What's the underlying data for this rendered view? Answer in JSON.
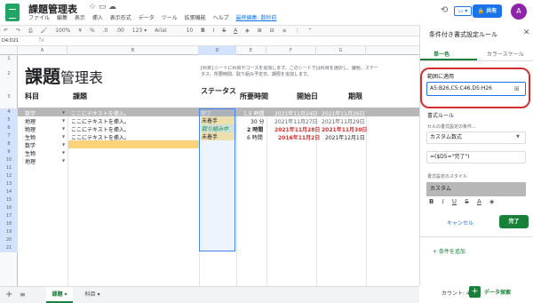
{
  "app": {
    "title": "課題管理表",
    "last_edit": "最終編集: 数秒前"
  },
  "menu": {
    "file": "ファイル",
    "edit": "編集",
    "view": "表示",
    "insert": "挿入",
    "format": "表示形式",
    "data": "データ",
    "tools": "ツール",
    "extensions": "拡張機能",
    "help": "ヘルプ"
  },
  "header": {
    "present": "▭ ▾",
    "share": "共有",
    "avatar": "A"
  },
  "toolbar": {
    "zoom": "100%",
    "percent": "%",
    "dec0": ".0",
    "dec00": ".00",
    "numfmt": "123 ▾",
    "font": "Arial",
    "fontsize": "10",
    "bold": "B",
    "italic": "I",
    "strike": "S",
    "color": "A"
  },
  "formula_bar": {
    "namebox": "D4:D21",
    "fx": "fx"
  },
  "columns": [
    "A",
    "B",
    "C",
    "D",
    "E",
    "F",
    "G"
  ],
  "rows": [
    "1",
    "2",
    "3",
    "4",
    "5",
    "6",
    "7",
    "8",
    "9",
    "10",
    "11",
    "12",
    "13",
    "14",
    "15",
    "16",
    "17",
    "18",
    "19",
    "20",
    "21"
  ],
  "sheet": {
    "title": "課題",
    "title_rest": "管理表",
    "desc": "[科目] シートに科目やコースを追加します。このシートでは科目を選択し、課題、ステータス、所要時間、取り組み予定日、期限を追加します。",
    "headers": {
      "subject": "科目",
      "task": "課題",
      "status": "ステータス",
      "time": "所要時間",
      "start": "開始日",
      "due": "期限"
    },
    "rows": [
      {
        "subject": "数学",
        "task": "ここにテキストを挿入。",
        "status": "完了",
        "time": "1.5 時間",
        "start": "2021年11月24日",
        "due": "2021年11月26日"
      },
      {
        "subject": "地理",
        "task": "ここにテキストを挿入。",
        "status": "未着手",
        "time": "30 分",
        "start": "2021年11月27日",
        "due": "2021年11月29日"
      },
      {
        "subject": "物理",
        "task": "ここにテキストを挿入。",
        "status": "取り組み中",
        "time": "2 時間",
        "start": "2021年11月28日",
        "due": "2021年11月30日"
      },
      {
        "subject": "生物",
        "task": "ここにテキストを挿入。",
        "status": "未着手",
        "time": "6 時間",
        "start": "2016年11月2日",
        "due": "2021年12月1日"
      },
      {
        "subject": "数学",
        "task": "",
        "status": "",
        "time": "",
        "start": "",
        "due": ""
      },
      {
        "subject": "生物",
        "task": "",
        "status": "",
        "time": "",
        "start": "",
        "due": ""
      },
      {
        "subject": "地理",
        "task": "",
        "status": "",
        "time": "",
        "start": "",
        "due": ""
      }
    ]
  },
  "tabs": {
    "plus": "+",
    "list": "≡",
    "sheet1": "課題 ▾",
    "sheet2": "科目 ▾"
  },
  "status_bar": {
    "count": "カウント: 4",
    "explore": "データ探索"
  },
  "panel": {
    "title": "条件付き書式設定ルール",
    "close": "✕",
    "tab_single": "単一色",
    "tab_scale": "カラースケール",
    "range_label": "範囲に適用",
    "range_value": "A5:B26,C5:C46,D5:H26",
    "rule_label": "書式ルール",
    "cond_label": "セルの書式設定の条件...",
    "cond_value": "カスタム数式",
    "formula": "=($D5=\"完了\")",
    "style_label": "書式設定のスタイル",
    "style_value": "カスタム",
    "cancel": "キャンセル",
    "done": "完了",
    "add_rule": "+ 条件を追加"
  },
  "colors": {
    "accent": "#188038",
    "done_row": "#b7b7b7",
    "red": "#d32f2f",
    "blue": "#1a73e8"
  }
}
